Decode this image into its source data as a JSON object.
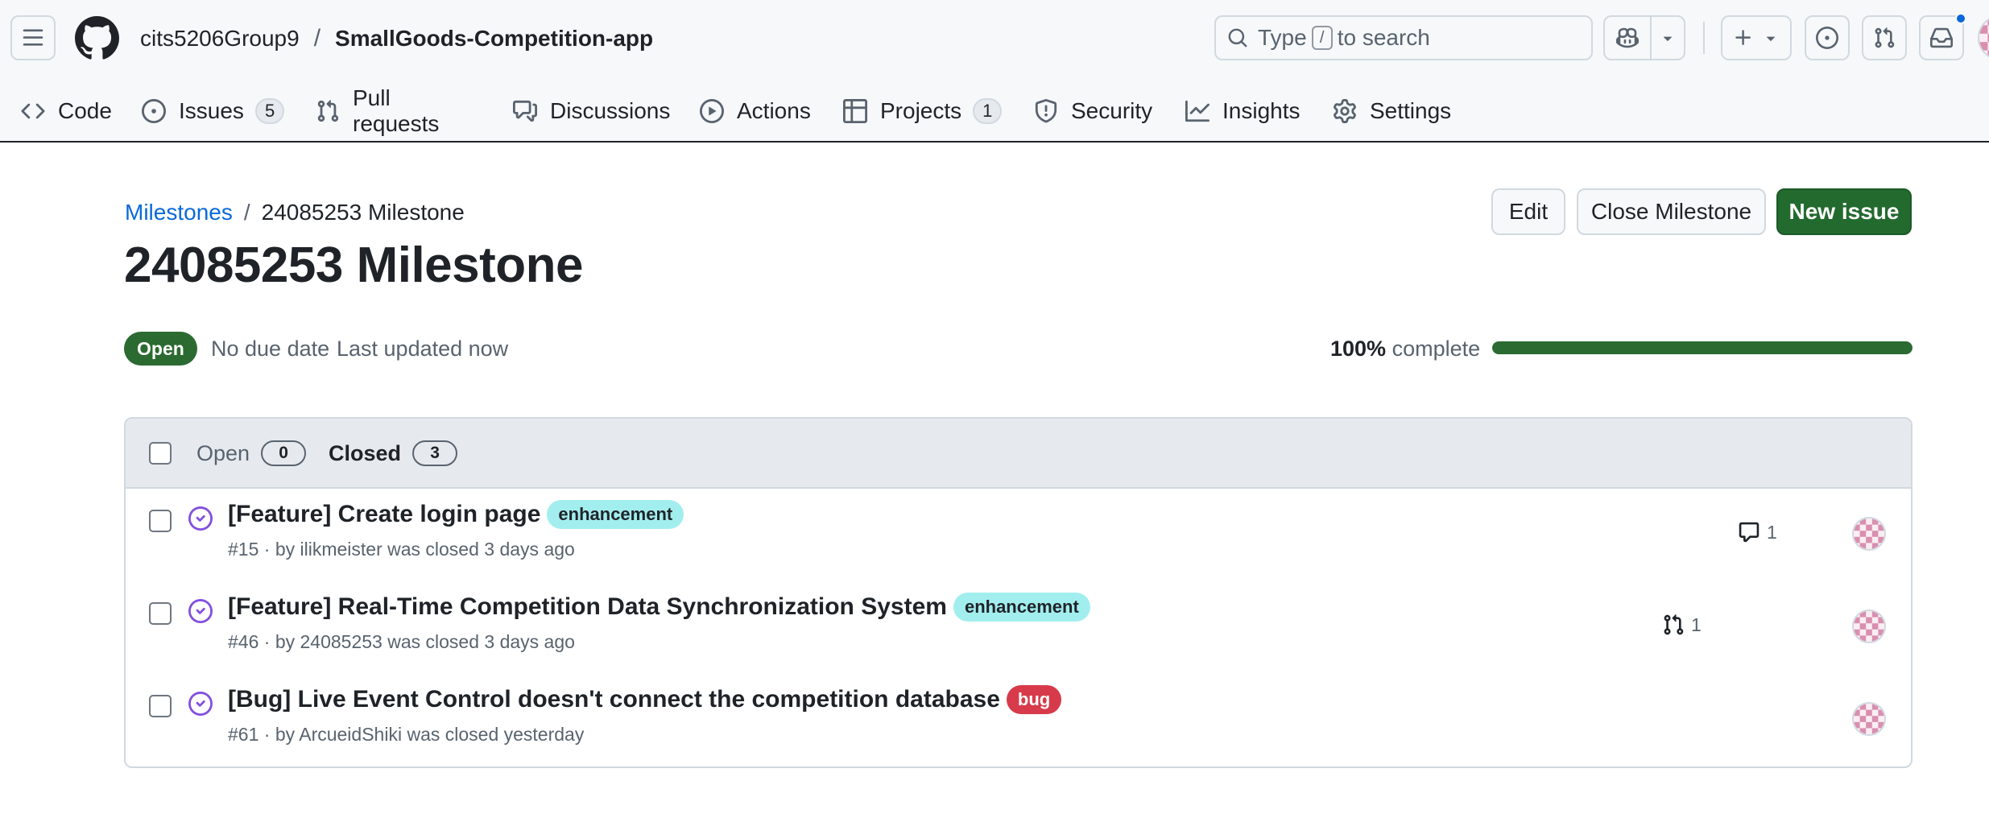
{
  "header": {
    "owner": "cits5206Group9",
    "separator": "/",
    "repo": "SmallGoods-Competition-app",
    "search": {
      "prefix": "Type",
      "key": "/",
      "suffix": "to search"
    }
  },
  "tabs": [
    {
      "label": "Code",
      "icon": "code-icon"
    },
    {
      "label": "Issues",
      "icon": "issue-opened-icon",
      "count": "5"
    },
    {
      "label": "Pull requests",
      "icon": "git-pull-request-icon"
    },
    {
      "label": "Discussions",
      "icon": "comment-discussion-icon"
    },
    {
      "label": "Actions",
      "icon": "play-icon"
    },
    {
      "label": "Projects",
      "icon": "table-icon",
      "count": "1"
    },
    {
      "label": "Security",
      "icon": "shield-icon"
    },
    {
      "label": "Insights",
      "icon": "graph-icon"
    },
    {
      "label": "Settings",
      "icon": "gear-icon"
    }
  ],
  "milestone": {
    "breadcrumb_link": "Milestones",
    "breadcrumb_sep": "/",
    "breadcrumb_current": "24085253 Milestone",
    "title": "24085253 Milestone",
    "state": "Open",
    "due": "No due date",
    "updated": "Last updated now",
    "percent": "100%",
    "complete_label": "complete",
    "progress": 1.0,
    "buttons": {
      "edit": "Edit",
      "close": "Close Milestone",
      "new_issue": "New issue"
    }
  },
  "issues": {
    "filters": {
      "open_label": "Open",
      "open_count": "0",
      "closed_label": "Closed",
      "closed_count": "3"
    },
    "rows": [
      {
        "title": "[Feature] Create login page",
        "label": "enhancement",
        "meta": "#15 · by ilikmeister was closed 3 days ago",
        "aside": "1",
        "aside_icon": "comment-icon"
      },
      {
        "title": "[Feature] Real-Time Competition Data Synchronization System",
        "label": "enhancement",
        "meta": "#46 · by 24085253 was closed 3 days ago",
        "aside": "1",
        "aside_icon": "git-pull-request-icon"
      },
      {
        "title": "[Bug] Live Event Control doesn't connect the competition database",
        "label": "bug",
        "meta": "#61 · by ArcueidShiki was closed yesterday",
        "aside": "",
        "aside_icon": ""
      }
    ]
  },
  "colors": {
    "accent_green": "#2b6a30",
    "link_blue": "#0969da",
    "enhancement_bg": "#a2eeef",
    "bug_bg": "#d73a4a",
    "closed_purple": "#8250df"
  }
}
